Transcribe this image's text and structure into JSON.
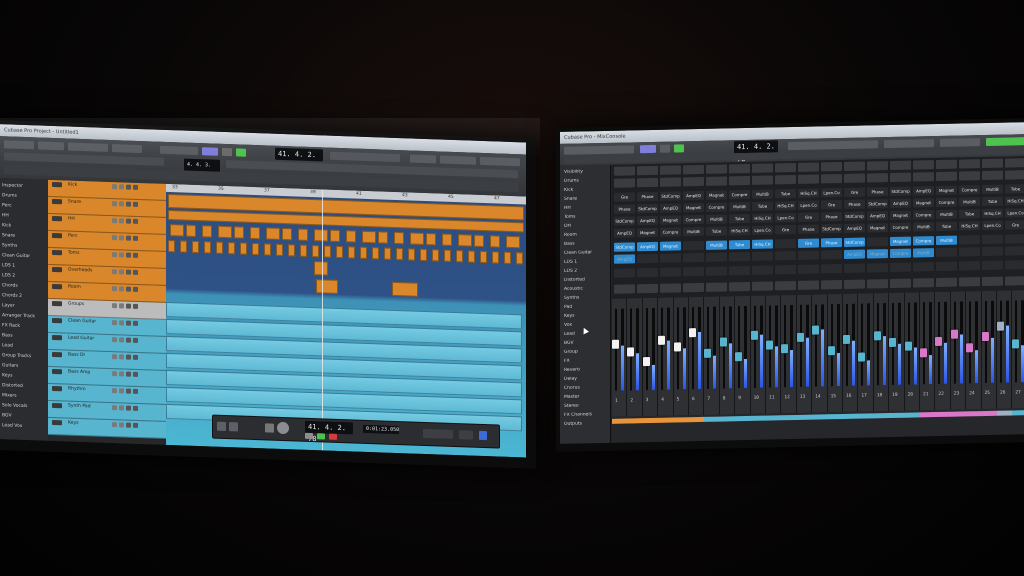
{
  "left": {
    "title": "Cubase Pro Project - Untitled1",
    "counter_main": "41. 4. 2. 78",
    "counter_small": "4. 4. 3. 0",
    "transport_counter": "41. 4. 2. 78",
    "transport_tempo": "0:01:23.050",
    "inspector": [
      "Inspector",
      "Drums",
      "Perc",
      "HH",
      "Kick",
      "Snare",
      "Synths",
      "Clean Guitar",
      "LDS 1",
      "LDS 2",
      "Chords",
      "Chords 2",
      "Layer",
      "Arranger Track",
      "FX Rack",
      "Bass",
      "Lead",
      "Group Tracks",
      "Guitars",
      "Keys",
      "Distorted",
      "Mixers",
      "Solo Vocals",
      "BGV",
      "Lead Vox"
    ],
    "tracks": [
      {
        "name": "Kick",
        "color": "#d9872a"
      },
      {
        "name": "Snare",
        "color": "#d9872a"
      },
      {
        "name": "HH",
        "color": "#d9872a"
      },
      {
        "name": "Perc",
        "color": "#d9872a"
      },
      {
        "name": "Toms",
        "color": "#d9872a"
      },
      {
        "name": "Overheads",
        "color": "#d9872a"
      },
      {
        "name": "Room",
        "color": "#d9872a"
      },
      {
        "name": "Groups",
        "color": "#bcbcbc"
      },
      {
        "name": "Clean Guitar",
        "color": "#58b5cf"
      },
      {
        "name": "Lead Guitar",
        "color": "#58b5cf"
      },
      {
        "name": "Bass DI",
        "color": "#58b5cf"
      },
      {
        "name": "Bass Amp",
        "color": "#58b5cf"
      },
      {
        "name": "Rhythm",
        "color": "#58b5cf"
      },
      {
        "name": "Synth Pad",
        "color": "#58b5cf"
      },
      {
        "name": "Keys",
        "color": "#58b5cf"
      }
    ],
    "ruler": [
      "33",
      "35",
      "37",
      "39",
      "41",
      "43",
      "45",
      "47"
    ]
  },
  "right": {
    "title": "Cubase Pro - MixConsole",
    "counter_main": "41. 4. 2. 78",
    "folders": [
      "Visibility",
      "Drums",
      "Kick",
      "Snare",
      "HH",
      "Toms",
      "OH",
      "Room",
      "Bass",
      "Clean Guitar",
      "LDS 1",
      "LDS 2",
      "Distorted",
      "Acoustic",
      "Synths",
      "Pad",
      "Keys",
      "Vox",
      "Lead",
      "BGV",
      "Group",
      "FX",
      "Reverb",
      "Delay",
      "Chorus",
      "Master",
      "Stereo",
      "FX Channels",
      "Outputs"
    ],
    "insert_labels": [
      "HiSq.CH",
      "Lpen.Co",
      "Gre",
      "Phase",
      "StdComp",
      "AmpEQ",
      "Magnet",
      "Compre",
      "MultiB",
      "Tube"
    ],
    "channels": [
      {
        "num": "1",
        "color": "#e8943a",
        "level": 0.55
      },
      {
        "num": "2",
        "color": "#e8943a",
        "level": 0.45
      },
      {
        "num": "3",
        "color": "#e8943a",
        "level": 0.3
      },
      {
        "num": "4",
        "color": "#e8943a",
        "level": 0.6
      },
      {
        "num": "5",
        "color": "#e8943a",
        "level": 0.5
      },
      {
        "num": "6",
        "color": "#e8943a",
        "level": 0.7
      },
      {
        "num": "7",
        "color": "#58b5cf",
        "level": 0.4
      },
      {
        "num": "8",
        "color": "#58b5cf",
        "level": 0.55
      },
      {
        "num": "9",
        "color": "#58b5cf",
        "level": 0.35
      },
      {
        "num": "10",
        "color": "#58b5cf",
        "level": 0.65
      },
      {
        "num": "11",
        "color": "#58b5cf",
        "level": 0.5
      },
      {
        "num": "12",
        "color": "#58b5cf",
        "level": 0.45
      },
      {
        "num": "13",
        "color": "#58b5cf",
        "level": 0.6
      },
      {
        "num": "14",
        "color": "#58b5cf",
        "level": 0.7
      },
      {
        "num": "15",
        "color": "#58b5cf",
        "level": 0.4
      },
      {
        "num": "16",
        "color": "#58b5cf",
        "level": 0.55
      },
      {
        "num": "17",
        "color": "#58b5cf",
        "level": 0.3
      },
      {
        "num": "18",
        "color": "#58b5cf",
        "level": 0.6
      },
      {
        "num": "19",
        "color": "#58b5cf",
        "level": 0.5
      },
      {
        "num": "20",
        "color": "#58b5cf",
        "level": 0.45
      },
      {
        "num": "21",
        "color": "#d977c9",
        "level": 0.35
      },
      {
        "num": "22",
        "color": "#d977c9",
        "level": 0.5
      },
      {
        "num": "23",
        "color": "#d977c9",
        "level": 0.6
      },
      {
        "num": "24",
        "color": "#d977c9",
        "level": 0.4
      },
      {
        "num": "25",
        "color": "#d977c9",
        "level": 0.55
      },
      {
        "num": "26",
        "color": "#9fb0c4",
        "level": 0.7
      },
      {
        "num": "27",
        "color": "#58b5cf",
        "level": 0.45
      }
    ]
  },
  "colors": {
    "orange_track": "#d9872a",
    "blue_track": "#58b5cf",
    "arrange_bg_top": "#2e4f80",
    "arrange_bg_bottom": "#49b8d3"
  }
}
